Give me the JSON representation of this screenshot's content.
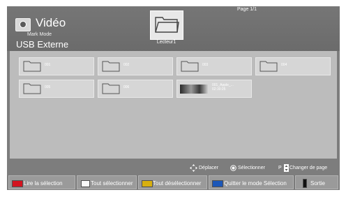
{
  "header": {
    "title": "Vidéo",
    "mode": "Mark Mode",
    "device": "USB Externe",
    "page": "Page 1/1",
    "drive_label": "Lecteur1"
  },
  "items": [
    {
      "name": "001",
      "kind": "folder"
    },
    {
      "name": "002",
      "kind": "folder"
    },
    {
      "name": "003",
      "kind": "folder"
    },
    {
      "name": "004",
      "kind": "folder"
    },
    {
      "name": "005",
      "kind": "folder"
    },
    {
      "name": "006",
      "kind": "folder"
    },
    {
      "name": "001_Apple_...",
      "time": "02:30:25",
      "kind": "video"
    }
  ],
  "hints": {
    "move": "Déplacer",
    "select": "Sélectionner",
    "page_key": "P",
    "change_page": "Changer de page"
  },
  "buttons": [
    {
      "label": "Lire la sélection",
      "color": "#d3131f"
    },
    {
      "label": "Tout sélectionner",
      "color": "#fafafa"
    },
    {
      "label": "Tout désélectionner",
      "color": "#d8b010"
    },
    {
      "label": "Quitter le mode Sélection",
      "color": "#1c57b8"
    },
    {
      "label": "Sortie",
      "color": "#111111"
    }
  ]
}
